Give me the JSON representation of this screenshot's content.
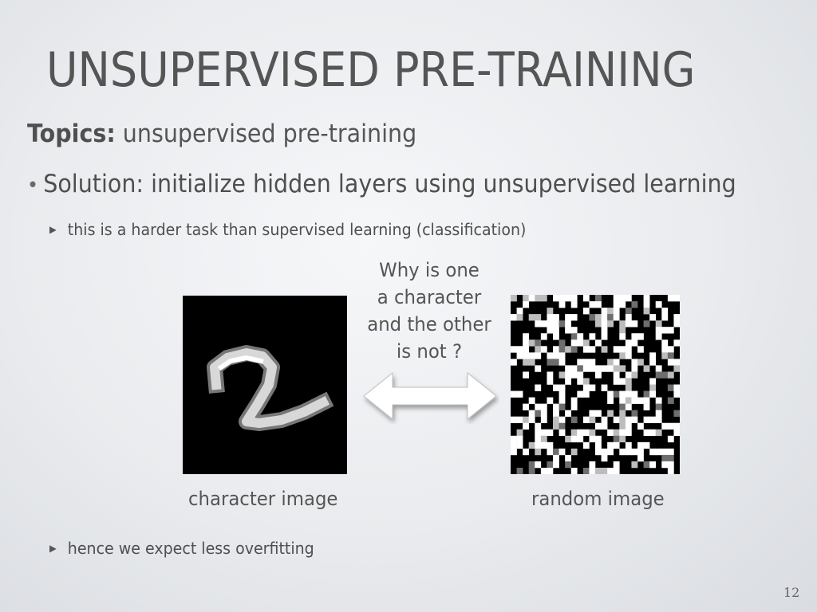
{
  "slide": {
    "title": "UNSUPERVISED PRE-TRAINING",
    "topics_label": "Topics:",
    "topics_text": " unsupervised pre-training",
    "bullet_marker": "•",
    "bullet_text": "Solution: initialize hidden layers using unsupervised learning",
    "sub_marker": "▶",
    "sub1": "this is a harder task than supervised learning (classification)",
    "question_lines": [
      "Why is one",
      "a character",
      "and the other",
      "is not ?"
    ],
    "caption_left": "character image",
    "caption_right": "random image",
    "sub2": "hence we expect less overfitting",
    "page_number": "12"
  }
}
